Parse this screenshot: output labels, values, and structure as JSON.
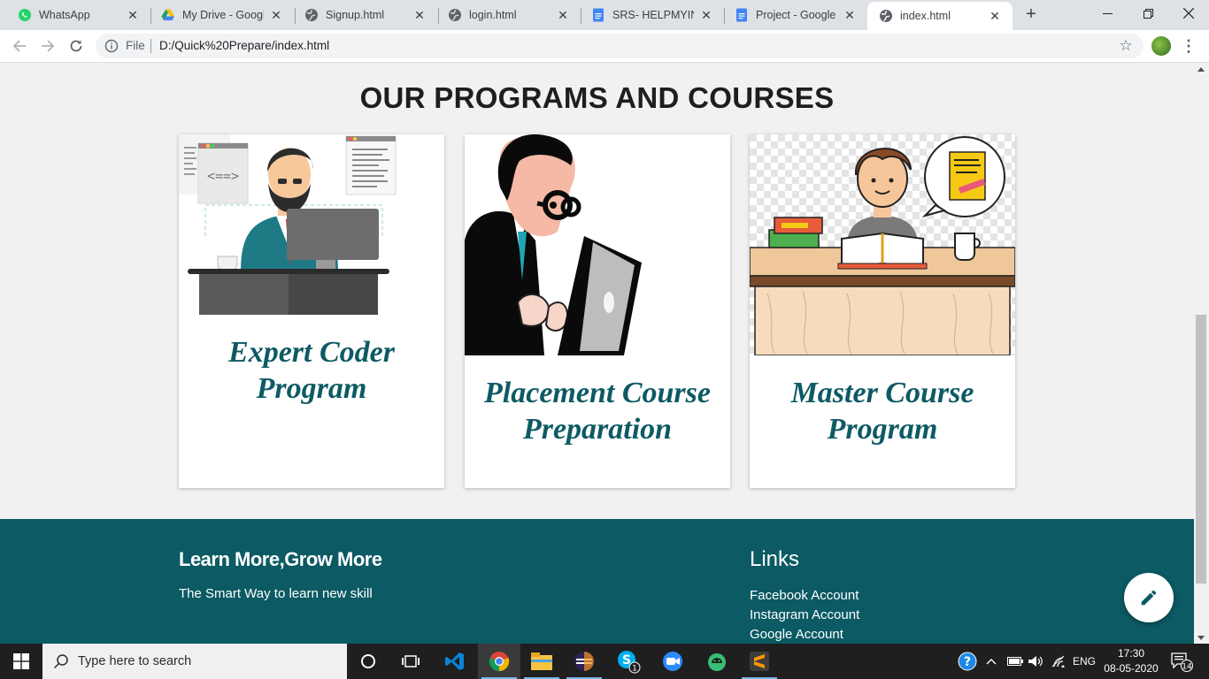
{
  "browser": {
    "tabs": [
      {
        "title": "WhatsApp",
        "icon": "whatsapp-icon"
      },
      {
        "title": "My Drive - Google",
        "icon": "google-drive-icon"
      },
      {
        "title": "Signup.html",
        "icon": "globe-icon"
      },
      {
        "title": "login.html",
        "icon": "globe-icon"
      },
      {
        "title": "SRS- HELPMYINTE",
        "icon": "google-docs-icon"
      },
      {
        "title": "Project - Google D",
        "icon": "google-docs-icon"
      },
      {
        "title": "index.html",
        "icon": "globe-icon"
      }
    ],
    "active_tab": 6,
    "address": {
      "scheme_label": "File",
      "url": "D:/Quick%20Prepare/index.html"
    }
  },
  "page": {
    "section_title": "OUR PROGRAMS AND COURSES",
    "cards": [
      {
        "title_line1": "Expert Coder",
        "title_line2": "Program",
        "image": "coder-illustration"
      },
      {
        "title_line1": "Placement Course",
        "title_line2": "Preparation",
        "image": "laptop-student-illustration"
      },
      {
        "title_line1": "Master Course",
        "title_line2": "Program",
        "image": "reading-student-illustration"
      }
    ],
    "footer": {
      "heading": "Learn More,Grow More",
      "tagline": "The Smart Way to learn new skill",
      "links_heading": "Links",
      "links": [
        "Facebook Account",
        "Instagram Account",
        "Google Account"
      ]
    }
  },
  "taskbar": {
    "search_placeholder": "Type here to search",
    "language": "ENG",
    "time": "17:30",
    "date": "08-05-2020",
    "skype_badge": "1",
    "notification_count": "14"
  },
  "colors": {
    "accent_teal": "#0b5a64",
    "card_title": "#0e5a64"
  }
}
